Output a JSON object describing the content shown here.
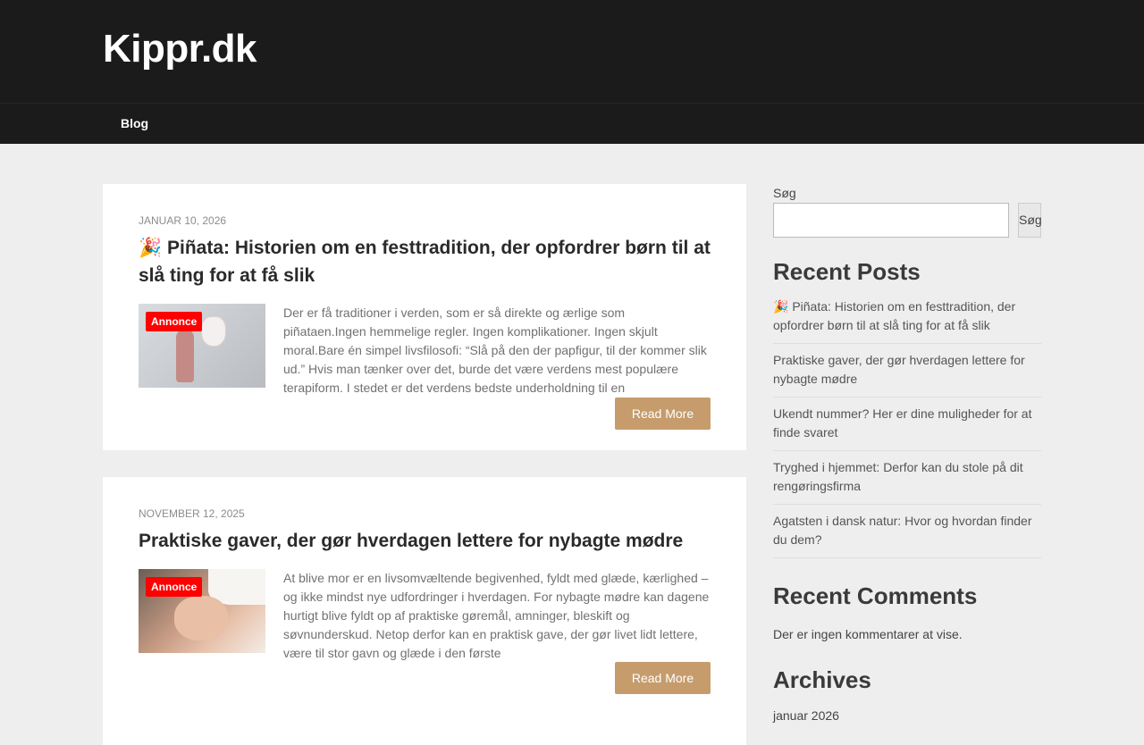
{
  "site": {
    "title": "Kippr.dk"
  },
  "nav": {
    "items": [
      "Blog"
    ]
  },
  "posts": [
    {
      "date": "Januar 10, 2026",
      "title": "🎉 Piñata: Historien om en festtradition, der opfordrer børn til at slå ting for at få slik",
      "badge": "Annonce",
      "excerpt": "Der er få traditioner i verden, som er så direkte og ærlige som piñataen.Ingen hemmelige regler. Ingen komplikationer. Ingen skjult moral.Bare én simpel livsfilosofi: “Slå på den der papfigur, til der kommer slik ud.” Hvis man tænker over det, burde det være verdens mest populære terapiform. I stedet er det verdens bedste underholdning til en",
      "read_more": "Read More"
    },
    {
      "date": "November 12, 2025",
      "title": "Praktiske gaver, der gør hverdagen lettere for nybagte mødre",
      "badge": "Annonce",
      "excerpt": "At blive mor er en livsomvæltende begivenhed, fyldt med glæde, kærlighed – og ikke mindst nye udfordringer i hverdagen. For nybagte mødre kan dagene hurtigt blive fyldt op af praktiske gøremål, amninger, bleskift og søvnunderskud. Netop derfor kan en praktisk gave, der gør livet lidt lettere, være til stor gavn og glæde i den første",
      "read_more": "Read More"
    }
  ],
  "sidebar": {
    "search_label": "Søg",
    "search_button": "Søg",
    "search_value": "",
    "recent_posts_title": "Recent Posts",
    "recent_posts": [
      "🎉 Piñata: Historien om en festtradition, der opfordrer børn til at slå ting for at få slik",
      "Praktiske gaver, der gør hverdagen lettere for nybagte mødre",
      "Ukendt nummer? Her er dine muligheder for at finde svaret",
      "Tryghed i hjemmet: Derfor kan du stole på dit rengøringsfirma",
      "Agatsten i dansk natur: Hvor og hvordan finder du dem?"
    ],
    "recent_comments_title": "Recent Comments",
    "no_comments": "Der er ingen kommentarer at vise.",
    "archives_title": "Archives",
    "archives": [
      "januar 2026"
    ]
  }
}
